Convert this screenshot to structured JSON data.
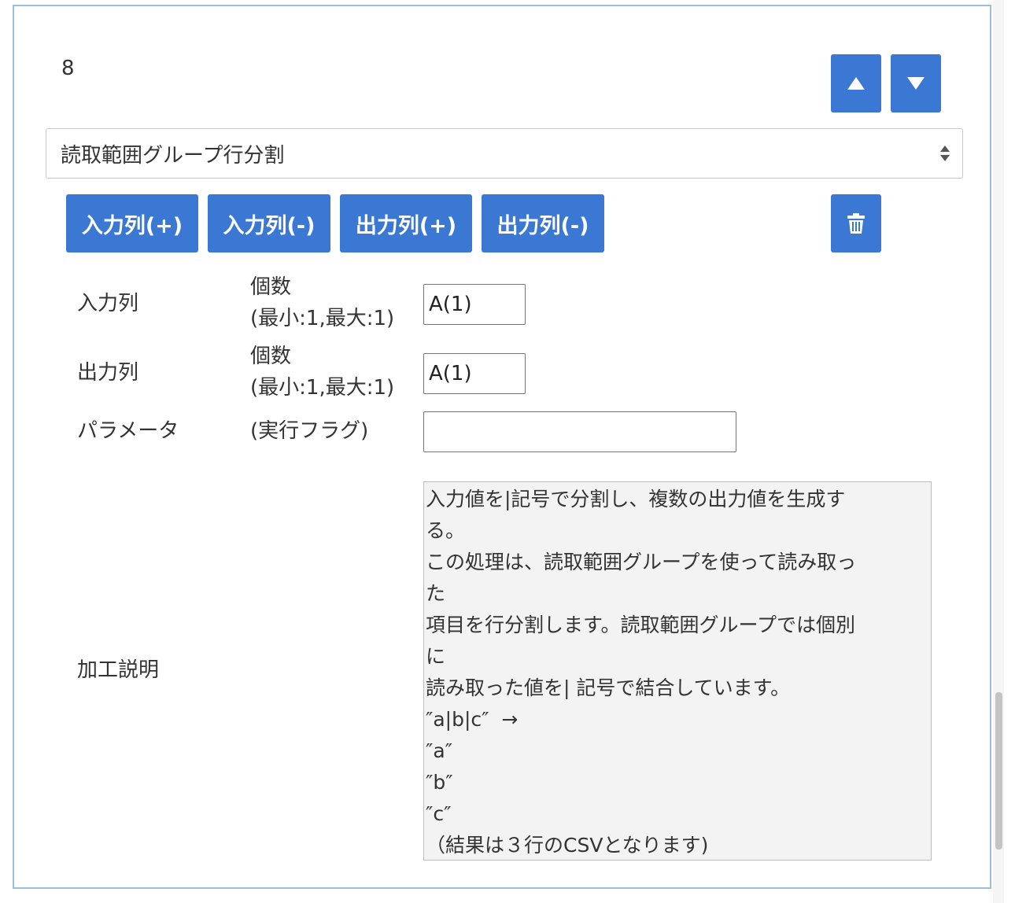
{
  "step": {
    "number": "8"
  },
  "buttons": {
    "move_up_icon": "triangle-up",
    "move_down_icon": "triangle-down",
    "input_col_add": "入力列(+)",
    "input_col_remove": "入力列(-)",
    "output_col_add": "出力列(+)",
    "output_col_remove": "出力列(-)",
    "delete_icon": "trash"
  },
  "process_select": {
    "value": "読取範囲グループ行分割"
  },
  "fields": {
    "input_col": {
      "label": "入力列",
      "sub_line1": "個数",
      "sub_line2": "(最小:1,最大:1)",
      "value": "A(1)"
    },
    "output_col": {
      "label": "出力列",
      "sub_line1": "個数",
      "sub_line2": "(最小:1,最大:1)",
      "value": "A(1)"
    },
    "parameter": {
      "label": "パラメータ",
      "sub": "(実行フラグ)",
      "value": ""
    },
    "description": {
      "label": "加工説明",
      "text": "入力値を|記号で分割し、複数の出力値を生成す\nる。\nこの処理は、読取範囲グループを使って読み取っ\nた\n項目を行分割します。読取範囲グループでは個別\nに\n読み取った値を| 記号で結合しています。\n″a|b|c″  →\n″a″\n″b″\n″c″\n（結果は３行のCSVとなります)"
    }
  },
  "colors": {
    "accent": "#3a78d3",
    "card_border": "#9cbfe4"
  }
}
